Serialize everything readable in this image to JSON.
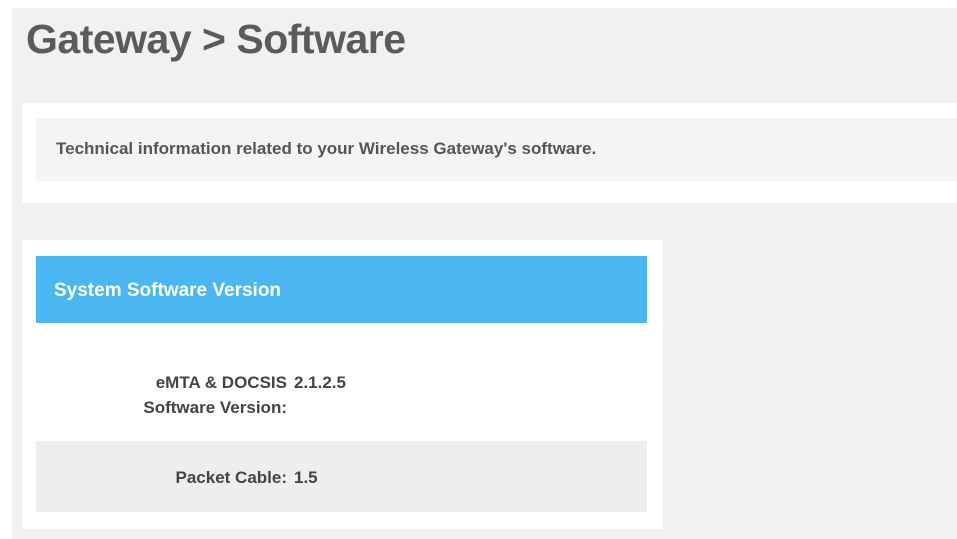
{
  "page": {
    "title": "Gateway > Software"
  },
  "info_card": {
    "text": "Technical information related to your Wireless Gateway's software."
  },
  "module": {
    "title": "System Software Version",
    "rows": [
      {
        "label_line1": "eMTA & DOCSIS",
        "label_line2": "Software Version:",
        "value": "2.1.2.5"
      },
      {
        "label_line1": "Packet Cable:",
        "value": "1.5"
      }
    ]
  },
  "colors": {
    "background": "#f1f1f1",
    "card": "#ffffff",
    "header_accent": "#4ab6f2",
    "title_text": "#5b5b5b",
    "body_text": "#444444",
    "alt_row": "#eeeeee"
  }
}
